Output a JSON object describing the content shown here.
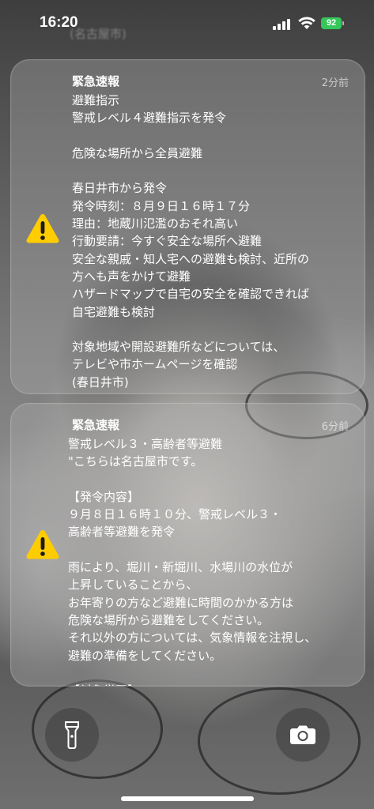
{
  "status_bar": {
    "time": "16:20",
    "battery": "92",
    "background_text": "(名古屋市)"
  },
  "notifications": [
    {
      "title": "緊急速報",
      "time_ago": "2分前",
      "icon": "warning-icon",
      "body": "避難指示\n警戒レベル４避難指示を発令\n\n危険な場所から全員避難\n\n春日井市から発令\n発令時刻：８月９日１６時１７分\n理由：地蔵川氾濫のおそれ高い\n行動要請：今すぐ安全な場所へ避難\n安全な親戚・知人宅への避難も検討、近所の\n方へも声をかけて避難\nハザードマップで自宅の安全を確認できれば\n自宅避難も検討\n\n対象地域や開設避難所などについては、\nテレビや市ホームページを確認\n(春日井市)"
    },
    {
      "title": "緊急速報",
      "time_ago": "6分前",
      "icon": "warning-icon",
      "body": "警戒レベル３・高齢者等避難\n\"こちらは名古屋市です。\n\n【発令内容】\n９月８日１６時１０分、警戒レベル３・\n高齢者等避難を発令\n\n雨により、堀川・新堀川、水場川の水位が\n上昇していることから、\nお年寄りの方など避難に時間のかかる方は\n危険な場所から避難をしてください。\nそれ以外の方については、気象情報を注視し、\n避難の準備をしてください。\n\n【対象学区】"
    }
  ],
  "bottom": {
    "left_button_icon": "flashlight-icon",
    "right_button_icon": "camera-icon"
  },
  "colors": {
    "warning": "#FFCC00",
    "battery": "#34C759"
  }
}
